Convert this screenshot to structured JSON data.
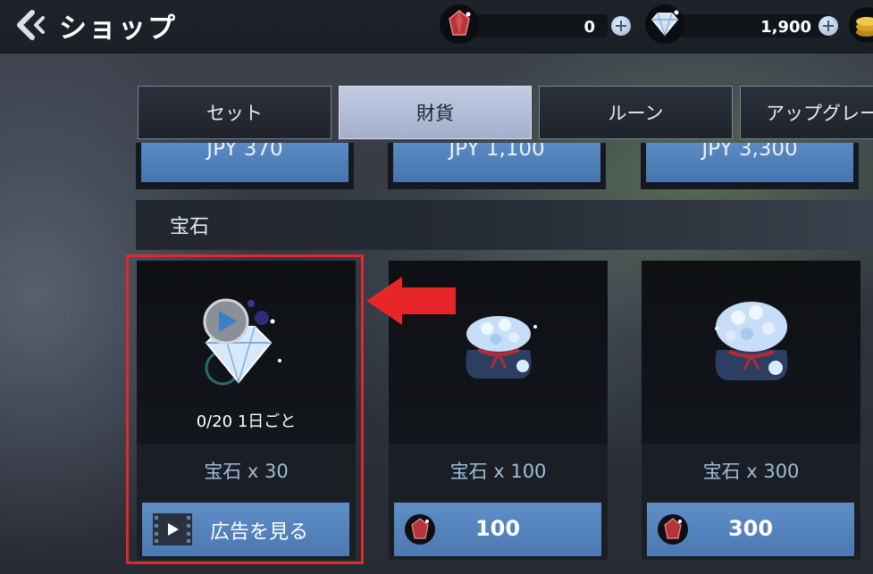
{
  "header": {
    "title": "ショップ",
    "currencies": [
      {
        "name": "ruby",
        "value": "0"
      },
      {
        "name": "gem",
        "value": "1,900"
      }
    ]
  },
  "tabs": [
    {
      "label": "セット",
      "active": false
    },
    {
      "label": "財貨",
      "active": true
    },
    {
      "label": "ルーン",
      "active": false
    },
    {
      "label": "アップグレー",
      "active": false
    }
  ],
  "top_prices": [
    "JPY 370",
    "JPY 1,100",
    "JPY 3,300"
  ],
  "section_title": "宝石",
  "products": [
    {
      "name": "宝石 x 30",
      "daily": "0/20 1日ごと",
      "button": "広告を見る",
      "icon": "video-ad-icon"
    },
    {
      "name": "宝石 x 100",
      "price": "100",
      "icon": "ruby-icon"
    },
    {
      "name": "宝石 x 300",
      "price": "300",
      "icon": "ruby-icon"
    }
  ],
  "colors": {
    "highlight": "#e8262a",
    "button_blue": "#5282bd",
    "tab_active": "#b4bdd8"
  }
}
